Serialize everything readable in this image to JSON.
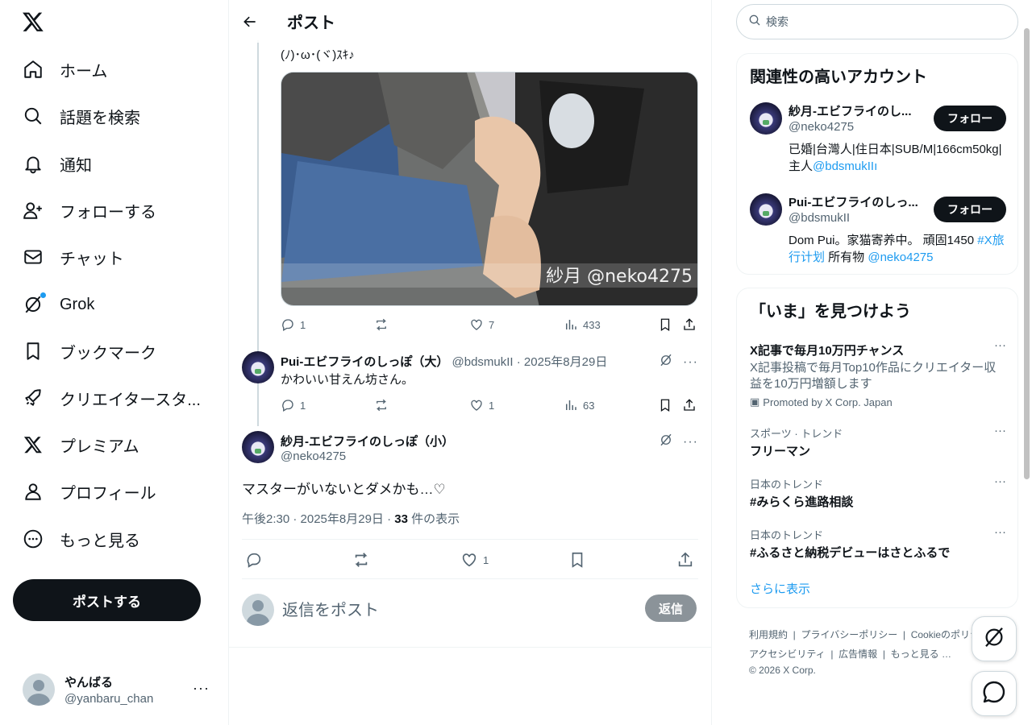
{
  "nav": {
    "items": [
      {
        "label": "ホーム",
        "icon": "home-icon"
      },
      {
        "label": "話題を検索",
        "icon": "search-icon"
      },
      {
        "label": "通知",
        "icon": "bell-icon"
      },
      {
        "label": "フォローする",
        "icon": "person-add-icon"
      },
      {
        "label": "チャット",
        "icon": "mail-icon"
      },
      {
        "label": "Grok",
        "icon": "grok-icon"
      },
      {
        "label": "ブックマーク",
        "icon": "bookmark-icon"
      },
      {
        "label": "クリエイタースタ...",
        "icon": "rocket-icon"
      },
      {
        "label": "プレミアム",
        "icon": "x-logo-icon"
      },
      {
        "label": "プロフィール",
        "icon": "person-icon"
      },
      {
        "label": "もっと見る",
        "icon": "more-circle-icon"
      }
    ],
    "post_button": "ポストする",
    "account": {
      "name": "やんばる",
      "handle": "@yanbaru_chan"
    }
  },
  "header": {
    "title": "ポスト"
  },
  "parent_tweet": {
    "text": "(ﾉ)･ω･(ヾ)ｽｷ♪",
    "photo_watermark": "紗月 @neko4275",
    "replies": "1",
    "likes": "7",
    "views": "433"
  },
  "reply_tweet": {
    "name": "Pui-エビフライのしっぽ（大）",
    "meta": "@bdsmukII · 2025年8月29日",
    "text": "かわいい甘えん坊さん。",
    "replies": "1",
    "likes": "1",
    "views": "63"
  },
  "focus_tweet": {
    "name": "紗月-エビフライのしっぽ（小）",
    "handle": "@neko4275",
    "text": "マスターがいないとダメかも…♡",
    "time": "午後2:30 · 2025年8月29日 · ",
    "views": "33",
    "views_suffix": " 件の表示",
    "likes": "1"
  },
  "compose": {
    "placeholder": "返信をポスト",
    "button": "返信"
  },
  "search": {
    "placeholder": "検索"
  },
  "related": {
    "title": "関連性の高いアカウント",
    "accounts": [
      {
        "name": "紗月-エビフライのし...",
        "handle": "@neko4275",
        "bio": "已婚|台灣人|住日本|SUB/M|166cm50kg|主人",
        "bio_link": "@bdsmukIIı",
        "follow": "フォロー"
      },
      {
        "name": "Pui-エビフライのしっ...",
        "handle": "@bdsmukII",
        "bio": "Dom Pui。家猫寄养中。 頑固1450 ",
        "bio_tag": "#X旅行计划",
        "bio_mid": " 所有物 ",
        "bio_link": "@neko4275",
        "follow": "フォロー"
      }
    ]
  },
  "trends": {
    "title": "「いま」を見つけよう",
    "promo": {
      "title": "X記事で毎月10万円チャンス",
      "desc": "X記事投稿で毎月Top10作品にクリエイター収益を10万円増額します",
      "promoted": "Promoted by X Corp. Japan"
    },
    "items": [
      {
        "category": "スポーツ · トレンド",
        "title": "フリーマン"
      },
      {
        "category": "日本のトレンド",
        "title": "#みらくら進路相談"
      },
      {
        "category": "日本のトレンド",
        "title": "#ふるさと納税デビューはさとふるで"
      }
    ],
    "more": "さらに表示"
  },
  "footer": {
    "links": [
      "利用規約",
      "プライバシーポリシー",
      "Cookieのポリシー",
      "アクセシビリティ",
      "広告情報",
      "もっと見る …"
    ],
    "copyright": "© 2026 X Corp."
  }
}
